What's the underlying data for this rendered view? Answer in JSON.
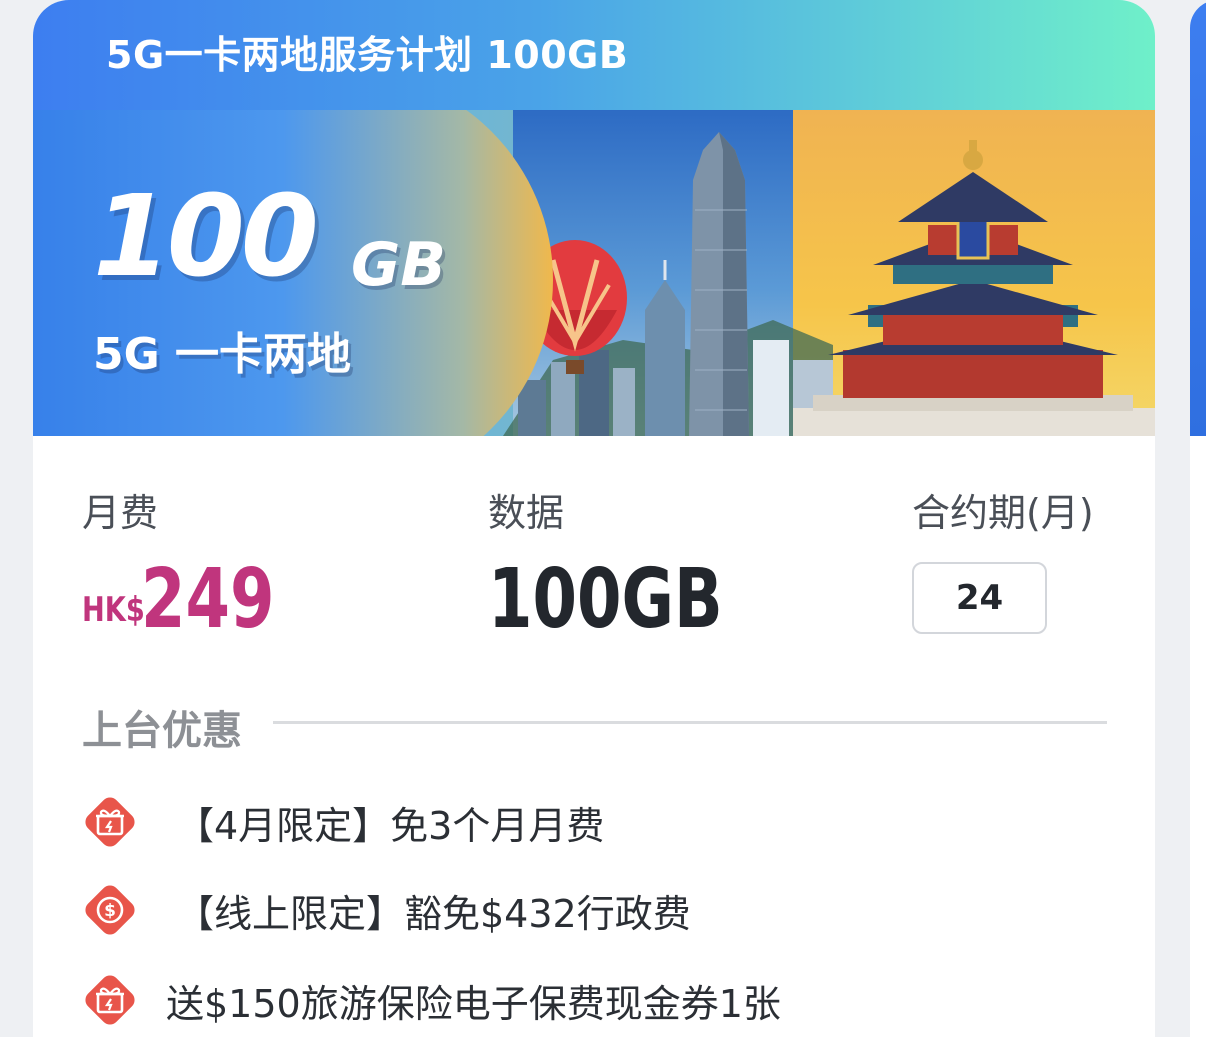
{
  "card": {
    "title": "5G一卡两地服务计划 100GB",
    "banner": {
      "headline_number": "100",
      "headline_unit": "GB",
      "subline": "5G 一卡两地"
    }
  },
  "plan": {
    "monthly_fee_label": "月费",
    "price_prefix": "HK$",
    "price_value": "249",
    "data_label": "数据",
    "data_value": "100GB",
    "contract_label": "合约期(月)",
    "contract_value": "24"
  },
  "offers": {
    "title": "上台优惠",
    "items": [
      {
        "icon": "gift-icon",
        "text": "【4月限定】免3个月月费"
      },
      {
        "icon": "dollar-icon",
        "text": "【线上限定】豁免$432行政费"
      },
      {
        "icon": "gift-icon",
        "text": "送$150旅游保险电子保费现金券1张"
      }
    ]
  },
  "colors": {
    "header_start": "#3d7ef0",
    "header_end": "#6ff0c9",
    "price": "#c0357d",
    "offer_icon": "#e8554a"
  }
}
